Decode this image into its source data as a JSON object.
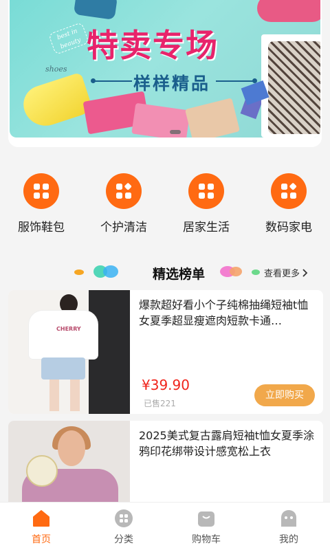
{
  "banner": {
    "title": "特卖专场",
    "subtitle": "样样精品",
    "tag_text": "best in beauty",
    "shoes_text": "shoes"
  },
  "categories": [
    {
      "label": "服饰鞋包",
      "icon": "grid-icon"
    },
    {
      "label": "个护清洁",
      "icon": "grid-diamond-icon"
    },
    {
      "label": "居家生活",
      "icon": "grid-icon"
    },
    {
      "label": "数码家电",
      "icon": "grid-diamond-icon"
    }
  ],
  "section": {
    "title": "精选榜单",
    "more_label": "查看更多"
  },
  "products": [
    {
      "title": "爆款超好看小个子纯棉抽绳短袖t恤女夏季超显瘦遮肉短款卡通…",
      "price": "¥39.90",
      "sold": "已售221",
      "buy_label": "立即购买",
      "image_text": "CHERRY"
    },
    {
      "title": "2025美式复古露肩短袖t恤女夏季涂鸦印花绑带设计感宽松上衣"
    }
  ],
  "tabbar": {
    "items": [
      {
        "label": "首页",
        "icon": "home-icon",
        "active": true
      },
      {
        "label": "分类",
        "icon": "category-icon",
        "active": false
      },
      {
        "label": "购物车",
        "icon": "cart-icon",
        "active": false
      },
      {
        "label": "我的",
        "icon": "profile-icon",
        "active": false
      }
    ]
  },
  "colors": {
    "accent": "#ff6a12",
    "price": "#f0241b",
    "buy_button": "#f1a84b"
  }
}
